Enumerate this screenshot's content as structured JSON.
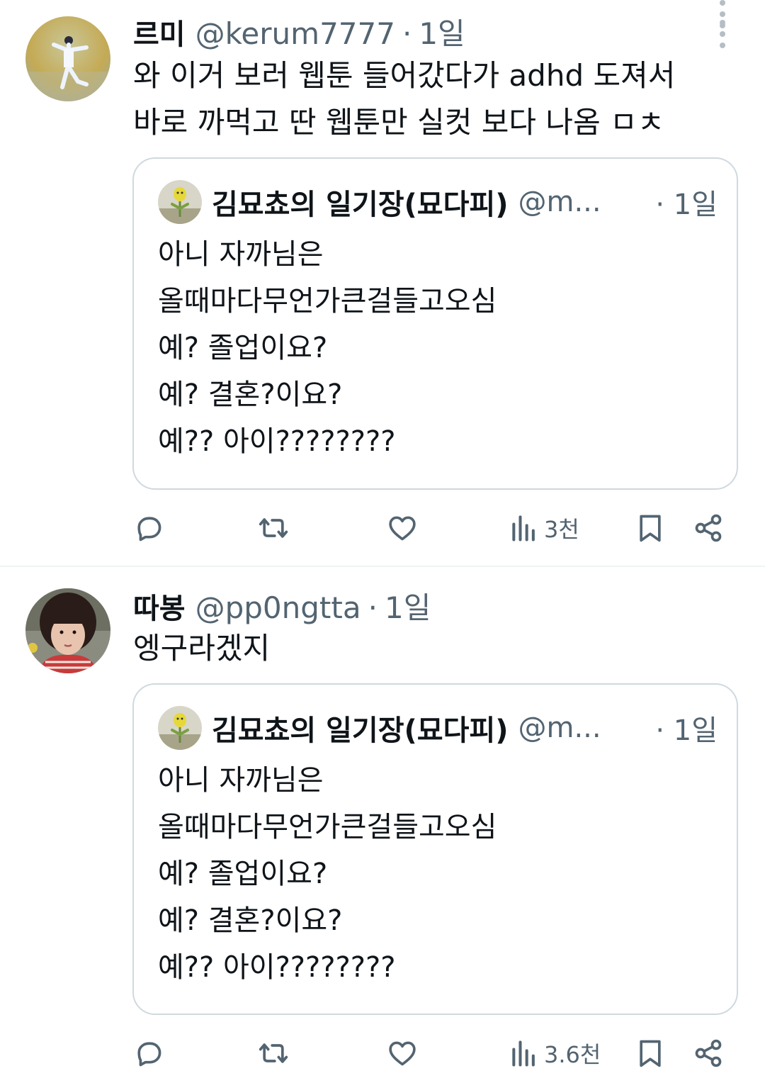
{
  "tweets": [
    {
      "author": {
        "name": "르미",
        "handle": "@kerum7777",
        "dot": "·",
        "time": "1일"
      },
      "text_lines": [
        "와 이거 보러 웹툰 들어갔다가 adhd 도져서",
        "바로 까먹고 딴 웹툰만 실컷 보다 나옴 ㅁㅊ"
      ],
      "quote": {
        "name": "김묘쵸의 일기장(묘다피)",
        "handle": "@m...",
        "time": "· 1일",
        "lines": [
          "아니 자까님은",
          "올때마다무언가큰걸들고오심",
          "예? 졸업이요?",
          "예? 결혼?이요?",
          "예?? 아이????????"
        ]
      },
      "actions": {
        "views": "3천"
      }
    },
    {
      "author": {
        "name": "따봉",
        "handle": "@pp0ngtta",
        "dot": "·",
        "time": "1일"
      },
      "text_lines": [
        "엥구라겠지"
      ],
      "quote": {
        "name": "김묘쵸의 일기장(묘다피)",
        "handle": "@m...",
        "time": "· 1일",
        "lines": [
          "아니 자까님은",
          "올때마다무언가큰걸들고오심",
          "예? 졸업이요?",
          "예? 결혼?이요?",
          "예?? 아이????????"
        ]
      },
      "actions": {
        "views": "3.6천"
      }
    }
  ],
  "icons": {
    "reply": "reply-icon",
    "retweet": "retweet-icon",
    "like": "heart-icon",
    "views": "views-icon",
    "bookmark": "bookmark-icon",
    "share": "share-icon",
    "more": "more-icon"
  },
  "colors": {
    "text": "#0f1419",
    "secondary": "#536471",
    "border": "#cfd9de",
    "divider": "#eff3f4"
  }
}
